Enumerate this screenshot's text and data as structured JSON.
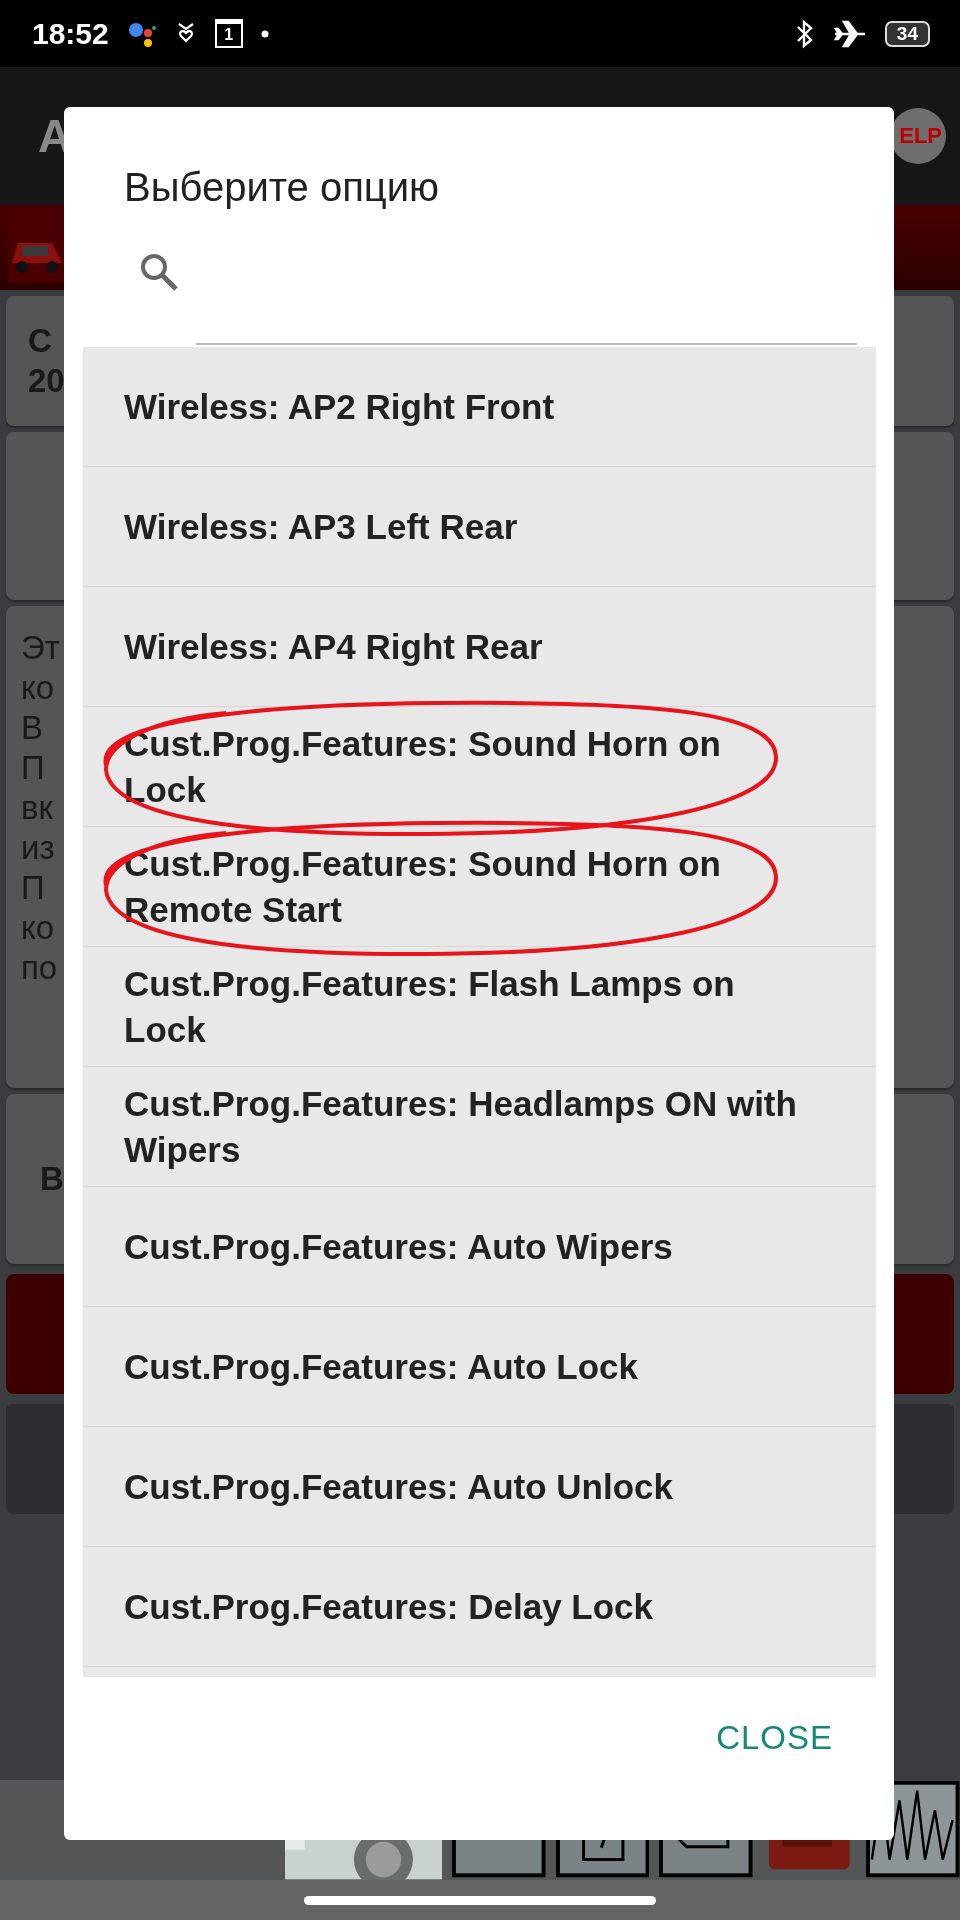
{
  "status_bar": {
    "time": "18:52",
    "calendar_day": "1",
    "battery": "34"
  },
  "background": {
    "app_title": "A",
    "help_button": "ELP",
    "info_card": [
      "С",
      "20"
    ],
    "text_card": [
      "Эт",
      "ко",
      "В",
      "П",
      "вк",
      "из",
      "П",
      "ко",
      "по"
    ],
    "button_card": "В"
  },
  "dialog": {
    "title": "Выберите опцию",
    "options": [
      {
        "label": "Wireless: AP2 Right Front",
        "circled": false
      },
      {
        "label": "Wireless: AP3 Left Rear",
        "circled": false
      },
      {
        "label": "Wireless: AP4 Right Rear",
        "circled": false
      },
      {
        "label": "Cust.Prog.Features: Sound Horn on\nLock",
        "circled": true
      },
      {
        "label": "Cust.Prog.Features: Sound Horn on\nRemote Start",
        "circled": true
      },
      {
        "label": "Cust.Prog.Features: Flash Lamps on\nLock",
        "circled": false
      },
      {
        "label": "Cust.Prog.Features: Headlamps ON with\nWipers",
        "circled": false
      },
      {
        "label": "Cust.Prog.Features: Auto Wipers",
        "circled": false
      },
      {
        "label": "Cust.Prog.Features: Auto Lock",
        "circled": false
      },
      {
        "label": "Cust.Prog.Features: Auto Unlock",
        "circled": false
      },
      {
        "label": "Cust.Prog.Features: Delay Lock",
        "circled": false
      }
    ],
    "close_button": "CLOSE"
  }
}
